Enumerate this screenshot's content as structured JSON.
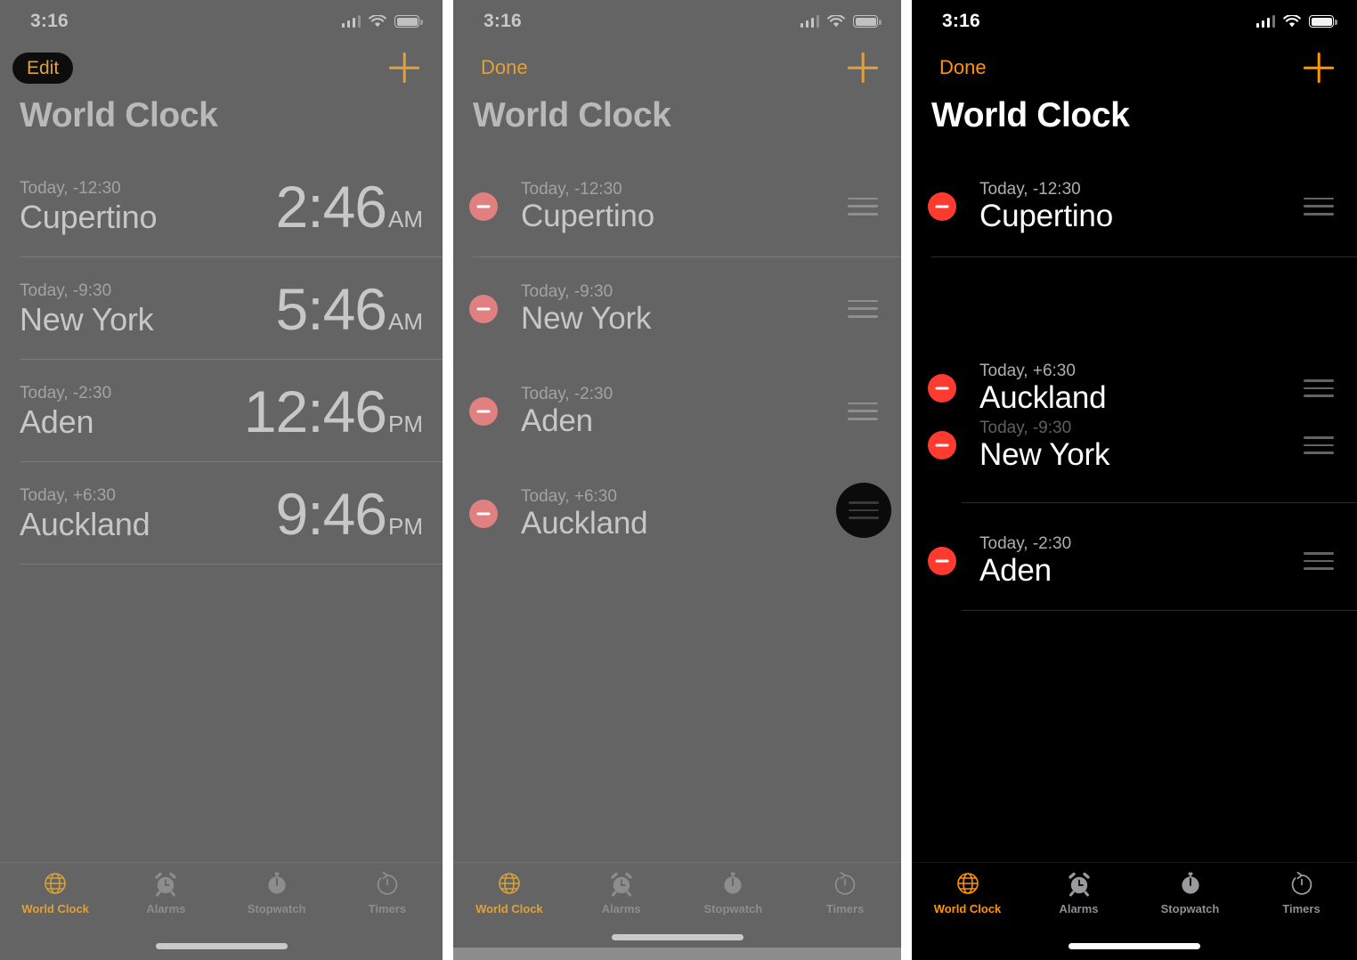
{
  "meta": {
    "app": "Clock",
    "screen": "World Clock",
    "colors": {
      "accent_orange": "#ff9500",
      "delete_red": "#ff3b30",
      "panel_dim_background": "#646464",
      "panel_active_background": "#000000",
      "text_primary": "#ffffff",
      "text_secondary": "#aeaeb2"
    }
  },
  "status_bar": {
    "time": "3:16",
    "signal_icon": "cellular-signal-icon",
    "wifi_icon": "wifi-icon",
    "battery_icon": "battery-icon"
  },
  "tab_bar": {
    "items": [
      {
        "label": "World Clock",
        "icon": "globe-icon",
        "active": true
      },
      {
        "label": "Alarms",
        "icon": "alarm-clock-icon",
        "active": false
      },
      {
        "label": "Stopwatch",
        "icon": "stopwatch-icon",
        "active": false
      },
      {
        "label": "Timers",
        "icon": "timer-icon",
        "active": false
      }
    ]
  },
  "panels": [
    {
      "id": "panel-1",
      "state": "normal",
      "dimmed": true,
      "nav": {
        "left_label": "Edit",
        "left_highlighted": true,
        "add_icon": "plus-icon"
      },
      "title": "World Clock",
      "rows": [
        {
          "offset": "Today, -12:30",
          "city": "Cupertino",
          "time": "2:46",
          "meridiem": "AM"
        },
        {
          "offset": "Today, -9:30",
          "city": "New York",
          "time": "5:46",
          "meridiem": "AM"
        },
        {
          "offset": "Today, -2:30",
          "city": "Aden",
          "time": "12:46",
          "meridiem": "PM"
        },
        {
          "offset": "Today, +6:30",
          "city": "Auckland",
          "time": "9:46",
          "meridiem": "PM"
        }
      ]
    },
    {
      "id": "panel-2",
      "state": "editing",
      "dimmed": true,
      "nav": {
        "left_label": "Done",
        "left_highlighted": false,
        "add_icon": "plus-icon"
      },
      "title": "World Clock",
      "rows": [
        {
          "offset": "Today, -12:30",
          "city": "Cupertino",
          "delete_icon": "minus-circle-icon",
          "drag_icon": "drag-handle-icon"
        },
        {
          "offset": "Today, -9:30",
          "city": "New York",
          "delete_icon": "minus-circle-icon",
          "drag_icon": "drag-handle-icon"
        },
        {
          "offset": "Today, -2:30",
          "city": "Aden",
          "delete_icon": "minus-circle-icon",
          "drag_icon": "drag-handle-icon"
        },
        {
          "offset": "Today, +6:30",
          "city": "Auckland",
          "delete_icon": "minus-circle-icon",
          "drag_icon": "drag-handle-icon"
        }
      ],
      "tap_target": {
        "row_city": "Auckland",
        "target_icon": "drag-handle-icon"
      }
    },
    {
      "id": "panel-3",
      "state": "editing-reordering",
      "dimmed": false,
      "nav": {
        "left_label": "Done",
        "left_highlighted": false,
        "add_icon": "plus-icon"
      },
      "title": "World Clock",
      "rows": [
        {
          "offset": "Today, -12:30",
          "city": "Cupertino",
          "delete_icon": "minus-circle-icon",
          "drag_icon": "drag-handle-icon"
        },
        {
          "offset": "Today, +6:30",
          "city": "Auckland",
          "delete_icon": "minus-circle-icon",
          "drag_icon": "drag-handle-icon",
          "dragging": true
        },
        {
          "offset": "Today, -9:30",
          "city": "New York",
          "delete_icon": "minus-circle-icon",
          "drag_icon": "drag-handle-icon"
        },
        {
          "offset": "Today, -2:30",
          "city": "Aden",
          "delete_icon": "minus-circle-icon",
          "drag_icon": "drag-handle-icon"
        }
      ]
    }
  ]
}
